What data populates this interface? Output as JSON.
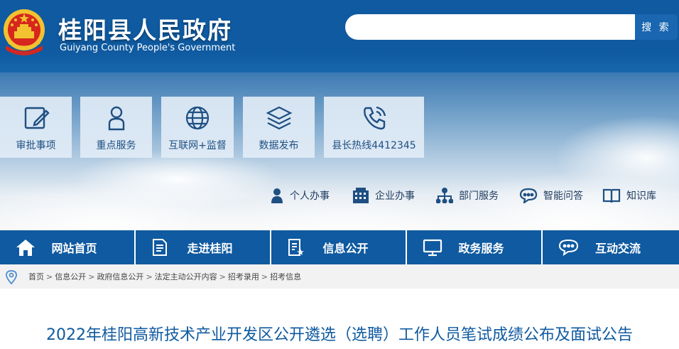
{
  "header": {
    "title": "桂阳县人民政府",
    "subtitle": "Guiyang County People's Government",
    "search": {
      "placeholder": "",
      "button_label": "搜 索"
    }
  },
  "quick_links": [
    {
      "label": "审批事项",
      "icon": "edit-icon"
    },
    {
      "label": "重点服务",
      "icon": "person-icon"
    },
    {
      "label": "互联网+监督",
      "icon": "globe-icon"
    },
    {
      "label": "数据发布",
      "icon": "layers-icon"
    },
    {
      "label": "县长热线4412345",
      "icon": "phone-icon"
    }
  ],
  "service_links": [
    {
      "label": "个人办事",
      "icon": "user-icon"
    },
    {
      "label": "企业办事",
      "icon": "building-icon"
    },
    {
      "label": "部门服务",
      "icon": "org-chart-icon"
    },
    {
      "label": "智能问答",
      "icon": "chat-icon"
    },
    {
      "label": "知识库",
      "icon": "book-icon"
    }
  ],
  "nav": [
    {
      "label": "网站首页",
      "icon": "home-icon"
    },
    {
      "label": "走进桂阳",
      "icon": "document-icon"
    },
    {
      "label": "信息公开",
      "icon": "document-star-icon"
    },
    {
      "label": "政务服务",
      "icon": "monitor-icon"
    },
    {
      "label": "互动交流",
      "icon": "chat-bubbles-icon"
    }
  ],
  "breadcrumb": [
    "首页",
    "信息公开",
    "政府信息公开",
    "法定主动公开内容",
    "招考录用",
    "招考信息"
  ],
  "breadcrumb_separator": ">",
  "article": {
    "title": "2022年桂阳高新技术产业开发区公开遴选（选聘）工作人员笔试成绩公布及面试公告"
  },
  "colors": {
    "header_blue": "#0f5aa0",
    "tile_text": "#1f4f82",
    "title_blue": "#0f5aa0"
  }
}
